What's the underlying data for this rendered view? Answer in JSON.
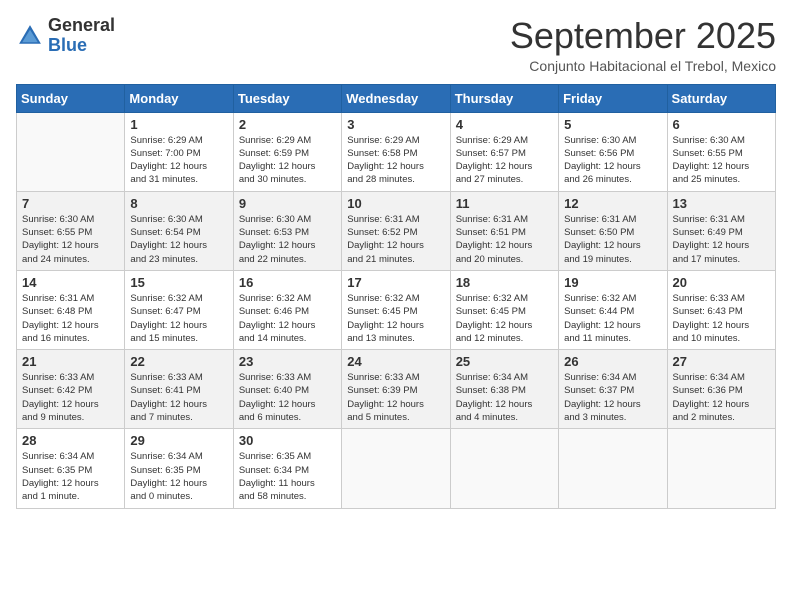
{
  "logo": {
    "general": "General",
    "blue": "Blue"
  },
  "title": "September 2025",
  "subtitle": "Conjunto Habitacional el Trebol, Mexico",
  "days_of_week": [
    "Sunday",
    "Monday",
    "Tuesday",
    "Wednesday",
    "Thursday",
    "Friday",
    "Saturday"
  ],
  "weeks": [
    [
      {
        "day": "",
        "info": ""
      },
      {
        "day": "1",
        "info": "Sunrise: 6:29 AM\nSunset: 7:00 PM\nDaylight: 12 hours\nand 31 minutes."
      },
      {
        "day": "2",
        "info": "Sunrise: 6:29 AM\nSunset: 6:59 PM\nDaylight: 12 hours\nand 30 minutes."
      },
      {
        "day": "3",
        "info": "Sunrise: 6:29 AM\nSunset: 6:58 PM\nDaylight: 12 hours\nand 28 minutes."
      },
      {
        "day": "4",
        "info": "Sunrise: 6:29 AM\nSunset: 6:57 PM\nDaylight: 12 hours\nand 27 minutes."
      },
      {
        "day": "5",
        "info": "Sunrise: 6:30 AM\nSunset: 6:56 PM\nDaylight: 12 hours\nand 26 minutes."
      },
      {
        "day": "6",
        "info": "Sunrise: 6:30 AM\nSunset: 6:55 PM\nDaylight: 12 hours\nand 25 minutes."
      }
    ],
    [
      {
        "day": "7",
        "info": "Sunrise: 6:30 AM\nSunset: 6:55 PM\nDaylight: 12 hours\nand 24 minutes."
      },
      {
        "day": "8",
        "info": "Sunrise: 6:30 AM\nSunset: 6:54 PM\nDaylight: 12 hours\nand 23 minutes."
      },
      {
        "day": "9",
        "info": "Sunrise: 6:30 AM\nSunset: 6:53 PM\nDaylight: 12 hours\nand 22 minutes."
      },
      {
        "day": "10",
        "info": "Sunrise: 6:31 AM\nSunset: 6:52 PM\nDaylight: 12 hours\nand 21 minutes."
      },
      {
        "day": "11",
        "info": "Sunrise: 6:31 AM\nSunset: 6:51 PM\nDaylight: 12 hours\nand 20 minutes."
      },
      {
        "day": "12",
        "info": "Sunrise: 6:31 AM\nSunset: 6:50 PM\nDaylight: 12 hours\nand 19 minutes."
      },
      {
        "day": "13",
        "info": "Sunrise: 6:31 AM\nSunset: 6:49 PM\nDaylight: 12 hours\nand 17 minutes."
      }
    ],
    [
      {
        "day": "14",
        "info": "Sunrise: 6:31 AM\nSunset: 6:48 PM\nDaylight: 12 hours\nand 16 minutes."
      },
      {
        "day": "15",
        "info": "Sunrise: 6:32 AM\nSunset: 6:47 PM\nDaylight: 12 hours\nand 15 minutes."
      },
      {
        "day": "16",
        "info": "Sunrise: 6:32 AM\nSunset: 6:46 PM\nDaylight: 12 hours\nand 14 minutes."
      },
      {
        "day": "17",
        "info": "Sunrise: 6:32 AM\nSunset: 6:45 PM\nDaylight: 12 hours\nand 13 minutes."
      },
      {
        "day": "18",
        "info": "Sunrise: 6:32 AM\nSunset: 6:45 PM\nDaylight: 12 hours\nand 12 minutes."
      },
      {
        "day": "19",
        "info": "Sunrise: 6:32 AM\nSunset: 6:44 PM\nDaylight: 12 hours\nand 11 minutes."
      },
      {
        "day": "20",
        "info": "Sunrise: 6:33 AM\nSunset: 6:43 PM\nDaylight: 12 hours\nand 10 minutes."
      }
    ],
    [
      {
        "day": "21",
        "info": "Sunrise: 6:33 AM\nSunset: 6:42 PM\nDaylight: 12 hours\nand 9 minutes."
      },
      {
        "day": "22",
        "info": "Sunrise: 6:33 AM\nSunset: 6:41 PM\nDaylight: 12 hours\nand 7 minutes."
      },
      {
        "day": "23",
        "info": "Sunrise: 6:33 AM\nSunset: 6:40 PM\nDaylight: 12 hours\nand 6 minutes."
      },
      {
        "day": "24",
        "info": "Sunrise: 6:33 AM\nSunset: 6:39 PM\nDaylight: 12 hours\nand 5 minutes."
      },
      {
        "day": "25",
        "info": "Sunrise: 6:34 AM\nSunset: 6:38 PM\nDaylight: 12 hours\nand 4 minutes."
      },
      {
        "day": "26",
        "info": "Sunrise: 6:34 AM\nSunset: 6:37 PM\nDaylight: 12 hours\nand 3 minutes."
      },
      {
        "day": "27",
        "info": "Sunrise: 6:34 AM\nSunset: 6:36 PM\nDaylight: 12 hours\nand 2 minutes."
      }
    ],
    [
      {
        "day": "28",
        "info": "Sunrise: 6:34 AM\nSunset: 6:35 PM\nDaylight: 12 hours\nand 1 minute."
      },
      {
        "day": "29",
        "info": "Sunrise: 6:34 AM\nSunset: 6:35 PM\nDaylight: 12 hours\nand 0 minutes."
      },
      {
        "day": "30",
        "info": "Sunrise: 6:35 AM\nSunset: 6:34 PM\nDaylight: 11 hours\nand 58 minutes."
      },
      {
        "day": "",
        "info": ""
      },
      {
        "day": "",
        "info": ""
      },
      {
        "day": "",
        "info": ""
      },
      {
        "day": "",
        "info": ""
      }
    ]
  ]
}
